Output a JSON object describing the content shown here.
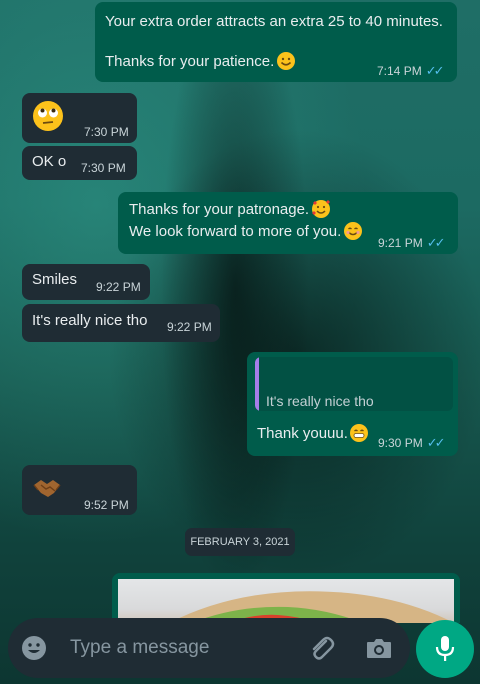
{
  "messages": [
    {
      "id": "m1",
      "direction": "out",
      "line1": "Your extra order attracts an extra 25 to 40 minutes.",
      "line2": "Thanks for your patience.",
      "time": "7:14 PM"
    },
    {
      "id": "m2",
      "direction": "in",
      "emoji": "eye-roll-emoji",
      "time": "7:30 PM"
    },
    {
      "id": "m3",
      "direction": "in",
      "text": "OK o",
      "time": "7:30 PM"
    },
    {
      "id": "m4",
      "direction": "out",
      "line1": "Thanks for your patronage.",
      "line2": "We look forward to more of you.",
      "time": "9:21 PM"
    },
    {
      "id": "m5",
      "direction": "in",
      "text": "Smiles",
      "time": "9:22 PM"
    },
    {
      "id": "m6",
      "direction": "in",
      "text": "It's really nice tho",
      "time": "9:22 PM"
    },
    {
      "id": "m7",
      "direction": "out",
      "quoted": "It's really nice tho",
      "text": "Thank youuu.",
      "time": "9:30 PM"
    },
    {
      "id": "m8",
      "direction": "in",
      "emoji": "handshake-emoji",
      "time": "9:52 PM"
    }
  ],
  "date_separator": "FEBRUARY 3, 2021",
  "composer": {
    "placeholder": "Type a message"
  },
  "colors": {
    "incoming": "#1f2c34",
    "outgoing": "#005c4b",
    "accent": "#00a884",
    "read_ticks": "#53bdeb"
  }
}
